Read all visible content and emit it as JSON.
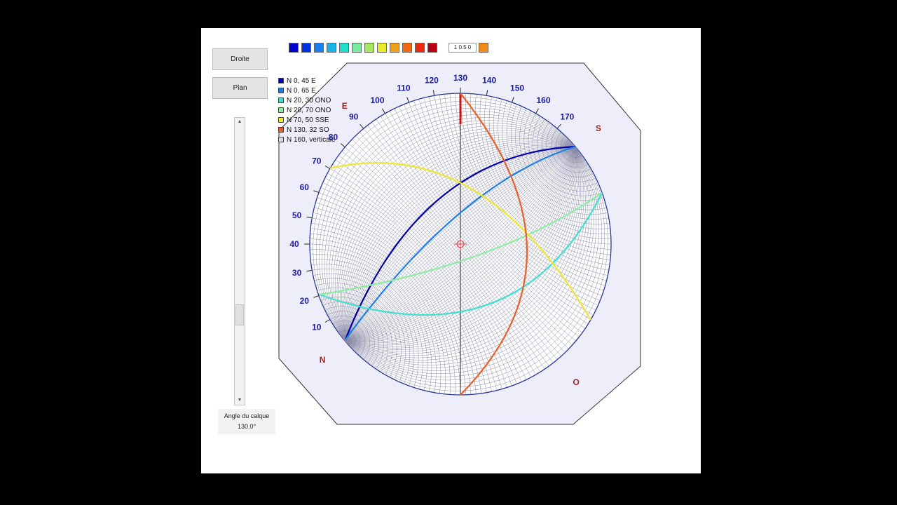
{
  "buttons": {
    "droite": "Droite",
    "plan": "Plan"
  },
  "angle": {
    "label": "Angle du calque",
    "value": "130.0°"
  },
  "palette": [
    "#0000cc",
    "#0033dd",
    "#1a7fe8",
    "#19b3e6",
    "#22dcd0",
    "#77ec9c",
    "#a6e860",
    "#e8ea2a",
    "#f0a018",
    "#f06a10",
    "#e82a10",
    "#b80012"
  ],
  "value_box": {
    "text": "1 0.5 0",
    "swatch": "#f08a18"
  },
  "legend": [
    {
      "label": "N 0, 45 E",
      "color": "#0000aa"
    },
    {
      "label": "N 0, 65 E",
      "color": "#1a7fe8"
    },
    {
      "label": "N 20, 30 ONO",
      "color": "#3ee0d0"
    },
    {
      "label": "N 20, 70 ONO",
      "color": "#8aee9e"
    },
    {
      "label": "N 70, 50 SSE",
      "color": "#f0e830"
    },
    {
      "label": "N 130, 32 SO",
      "color": "#e8602a"
    },
    {
      "label": "N 160, verticale",
      "color": "#d8d8e4"
    }
  ],
  "stereonet": {
    "rotation_deg": 130,
    "ticks": [
      "10",
      "20",
      "30",
      "40",
      "50",
      "60",
      "70",
      "80",
      "90",
      "100",
      "110",
      "120",
      "130",
      "140",
      "150",
      "160",
      "170"
    ],
    "directions": [
      "N",
      "E",
      "S",
      "O"
    ],
    "plane_colors": [
      "#0000aa",
      "#1a7fe8",
      "#3ee0d0",
      "#8aee9e",
      "#f0e830",
      "#e8602a"
    ]
  }
}
